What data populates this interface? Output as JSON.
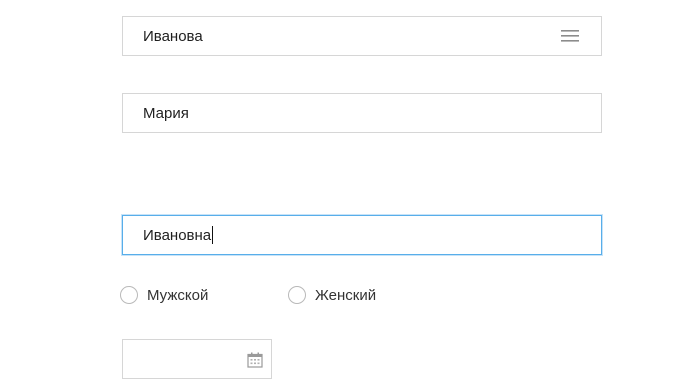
{
  "form": {
    "last_name": {
      "value": "Иванова",
      "icon": "menu-icon"
    },
    "first_name": {
      "value": "Мария"
    },
    "middle_name": {
      "value": "Ивановна",
      "focused": true
    },
    "gender": {
      "options": [
        {
          "label": "Мужской",
          "selected": false
        },
        {
          "label": "Женский",
          "selected": false
        }
      ]
    },
    "birth_date": {
      "value": "",
      "icon": "calendar-icon"
    }
  },
  "colors": {
    "border": "#d6d6d6",
    "focus_border": "#58aeea",
    "icon": "#8c8c8c"
  }
}
